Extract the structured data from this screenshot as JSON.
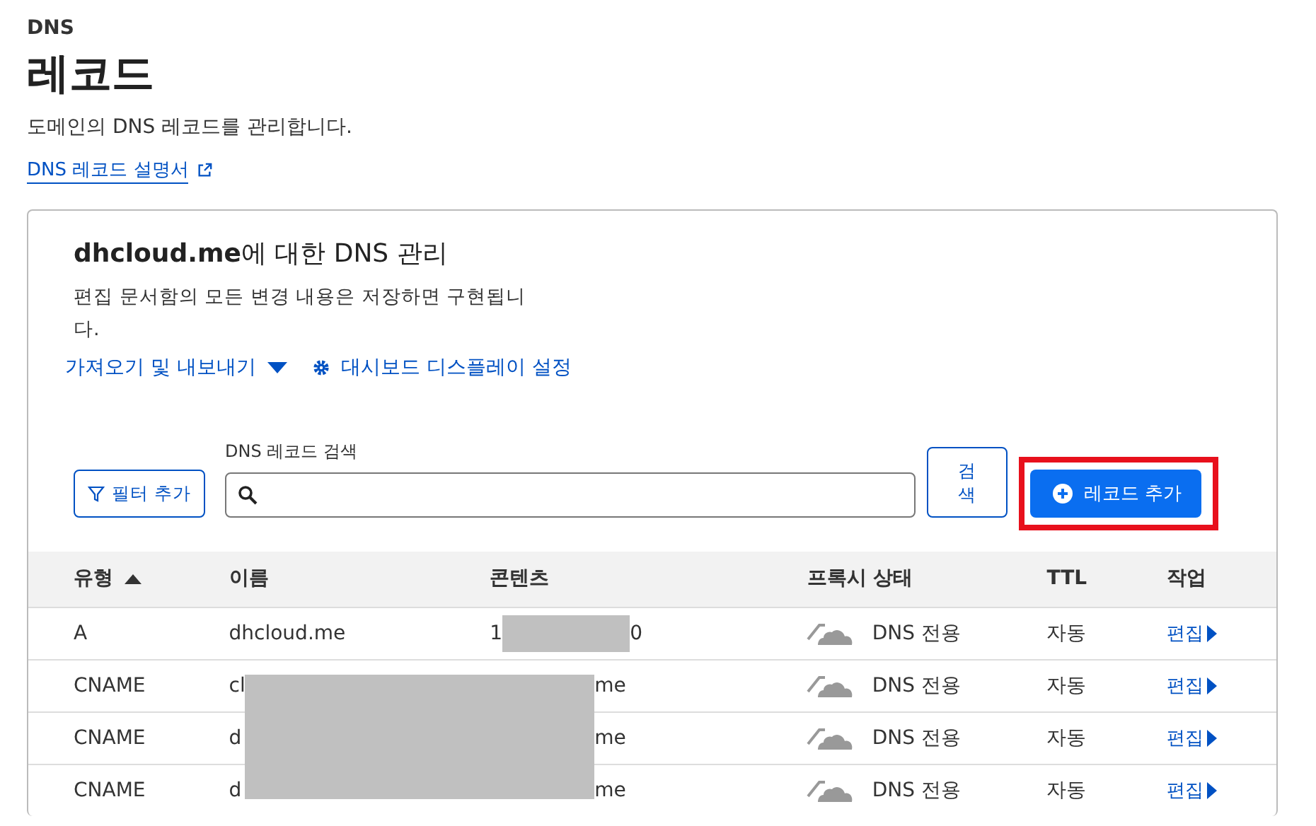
{
  "section": "DNS",
  "title": "레코드",
  "description": "도메인의 DNS 레코드를 관리합니다.",
  "docs_link": "DNS 레코드 설명서",
  "card": {
    "heading": "**dhcloud.me**에 대한 DNS 관리",
    "note": "편집 문서함의 모든 변경 내용은 저장하면 구현됩니\n다.",
    "import_export": "가져오기 및 내보내기",
    "dashboard_settings": "대시보드 디스플레이 설정",
    "filter_button": "필터 추가",
    "search": {
      "label": "DNS 레코드 검색"
    },
    "search_button": "검\n색",
    "add_button": "레코드 추가",
    "add_button_highlighted": true,
    "table": {
      "columns": [
        {
          "label": "유형",
          "sorted": true
        },
        {
          "label": "이름",
          "sorted": false
        },
        {
          "label": "콘텐츠",
          "sorted": false
        },
        {
          "label": "프록시 상태",
          "sorted": false
        },
        {
          "label": "TTL",
          "sorted": false
        },
        {
          "label": "작업",
          "sorted": false
        }
      ],
      "rows": [
        {
          "type": "A",
          "name": "dhcloud.me",
          "content": [
            "1",
            "0"
          ],
          "masked": false,
          "proxy": "DNS 전용",
          "ttl": "자동",
          "action": "편집"
        },
        {
          "type": "CNAME",
          "name": "cl",
          "content": [
            "me"
          ],
          "masked": true,
          "proxy": "DNS 전용",
          "ttl": "자동",
          "action": "편집"
        },
        {
          "type": "CNAME",
          "name": "d",
          "content": [
            "me"
          ],
          "masked": true,
          "proxy": "DNS 전용",
          "ttl": "자동",
          "action": "편집"
        },
        {
          "type": "CNAME",
          "name": "d",
          "content": [
            "me"
          ],
          "masked": true,
          "proxy": "DNS 전용",
          "ttl": "자동",
          "action": "편집"
        }
      ]
    }
  }
}
